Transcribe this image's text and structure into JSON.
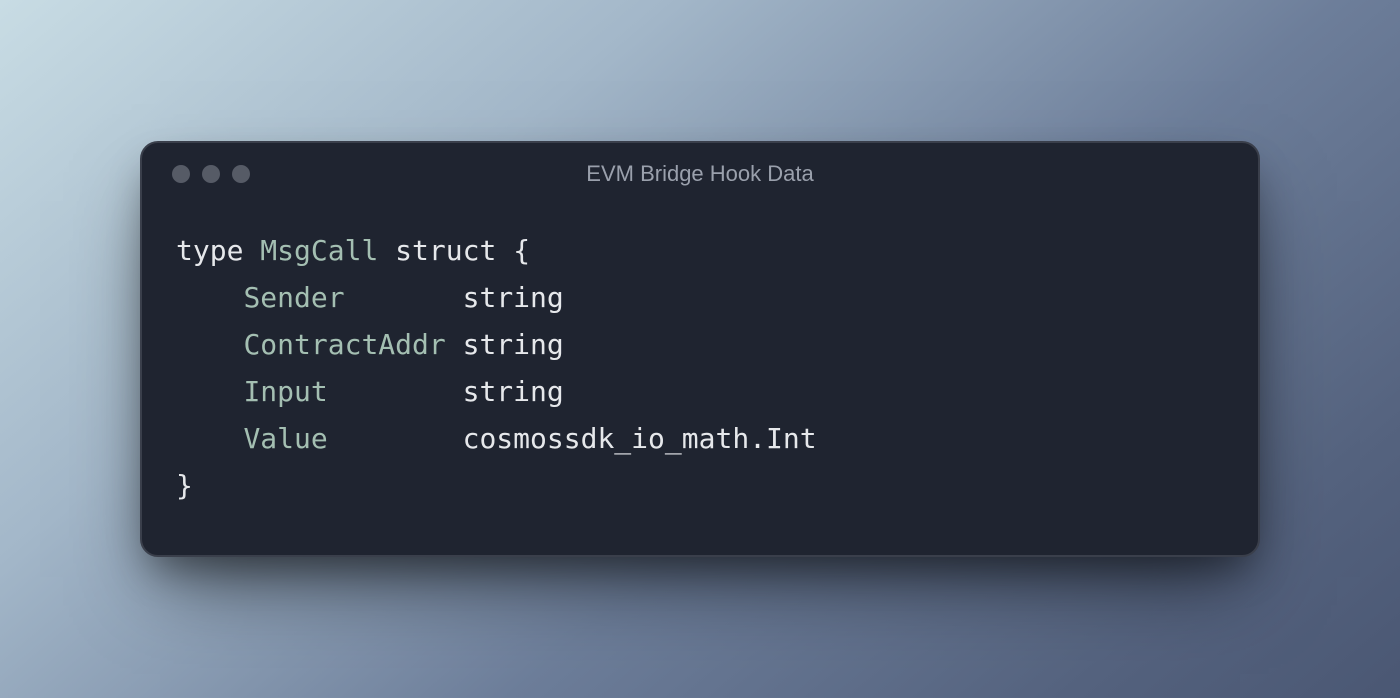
{
  "window": {
    "title": "EVM Bridge Hook Data"
  },
  "code": {
    "keyword_type": "type",
    "struct_name": "MsgCall",
    "keyword_struct": "struct",
    "brace_open": "{",
    "brace_close": "}",
    "fields": {
      "sender": {
        "name": "Sender",
        "type": "string"
      },
      "contractAddr": {
        "name": "ContractAddr",
        "type": "string"
      },
      "input": {
        "name": "Input",
        "type": "string"
      },
      "value": {
        "name": "Value",
        "type_pkg": "cosmossdk_io_math",
        "type_dot": ".",
        "type_ident": "Int"
      }
    }
  }
}
